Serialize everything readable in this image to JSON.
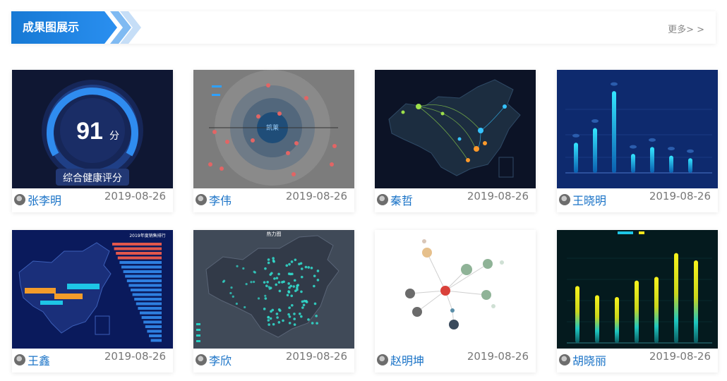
{
  "header": {
    "title": "成果图展示",
    "more": "更多> >"
  },
  "cards": [
    {
      "author": "张李明",
      "date": "2019-08-26",
      "thumb": {
        "gauge_value": "91",
        "gauge_unit": "分",
        "gauge_label": "综合健康评分"
      }
    },
    {
      "author": "李伟",
      "date": "2019-08-26",
      "thumb": {
        "center_label": "凯莱"
      }
    },
    {
      "author": "秦哲",
      "date": "2019-08-26",
      "thumb": {}
    },
    {
      "author": "王晓明",
      "date": "2019-08-26",
      "thumb": {
        "bars": [
          0.35,
          0.52,
          0.95,
          0.22,
          0.3,
          0.2,
          0.17
        ]
      }
    },
    {
      "author": "王鑫",
      "date": "2019-08-26",
      "thumb": {
        "title": "2019年度销售排行"
      }
    },
    {
      "author": "李欣",
      "date": "2019-08-26",
      "thumb": {
        "title": "热力图"
      }
    },
    {
      "author": "赵明坤",
      "date": "2019-08-26",
      "thumb": {}
    },
    {
      "author": "胡晓丽",
      "date": "2019-08-26",
      "thumb": {
        "bars": [
          0.62,
          0.52,
          0.5,
          0.68,
          0.72,
          0.98,
          0.9
        ]
      }
    }
  ],
  "colors": {
    "accent": "#1679d4",
    "author": "#1a73c7"
  }
}
